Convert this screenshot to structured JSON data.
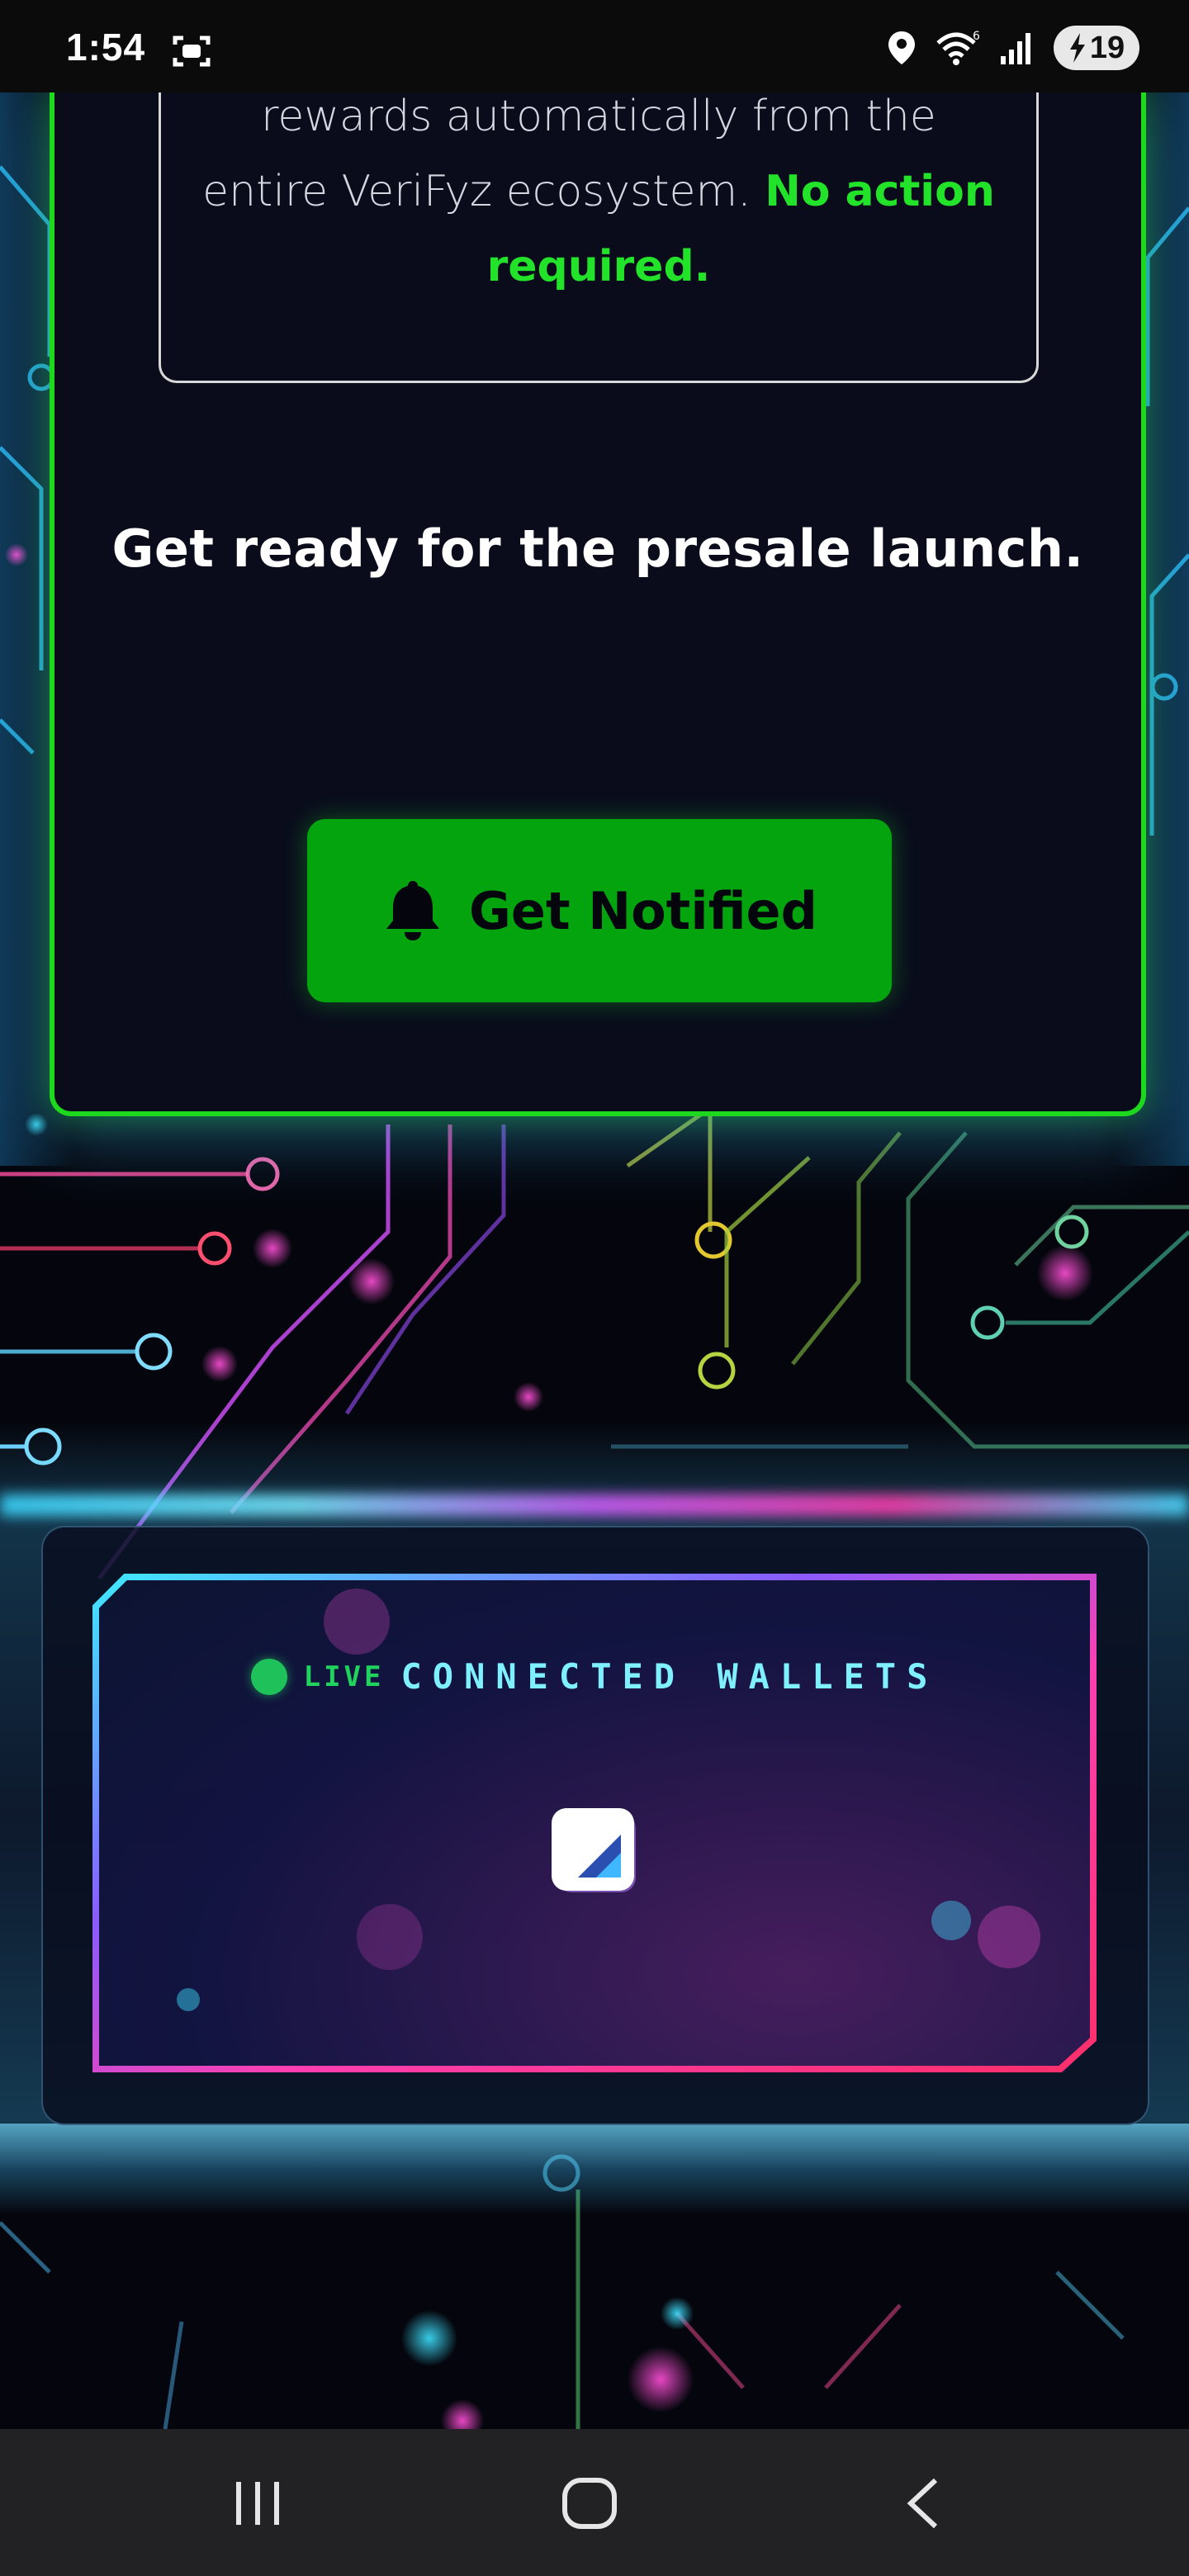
{
  "status_bar": {
    "time": "1:54",
    "battery_level": "19",
    "icons": [
      "screen-record-icon",
      "location-icon",
      "wifi-icon",
      "signal-icon",
      "battery-charging-icon"
    ]
  },
  "presale_card": {
    "rewards_text_line1": "rewards automatically from the",
    "rewards_text_line2": "entire VeriFyz ecosystem. ",
    "rewards_highlight_a": "No action",
    "rewards_highlight_b": "required.",
    "heading": "Get ready for the presale launch.",
    "notify_button_label": "Get Notified",
    "notify_icon": "bell-icon"
  },
  "wallet_section": {
    "live_label": "LIVE",
    "title": "CONNECTED WALLETS",
    "logo": "verifyz-logo-icon"
  },
  "nav_bar": {
    "icons": [
      "recent-apps-icon",
      "home-icon",
      "back-icon"
    ]
  },
  "colors": {
    "accent_green": "#22e22a",
    "button_green": "#03a40d",
    "live_green": "#1fc15a",
    "cyan": "#7ff0ff",
    "magenta": "#ff3fb0"
  }
}
